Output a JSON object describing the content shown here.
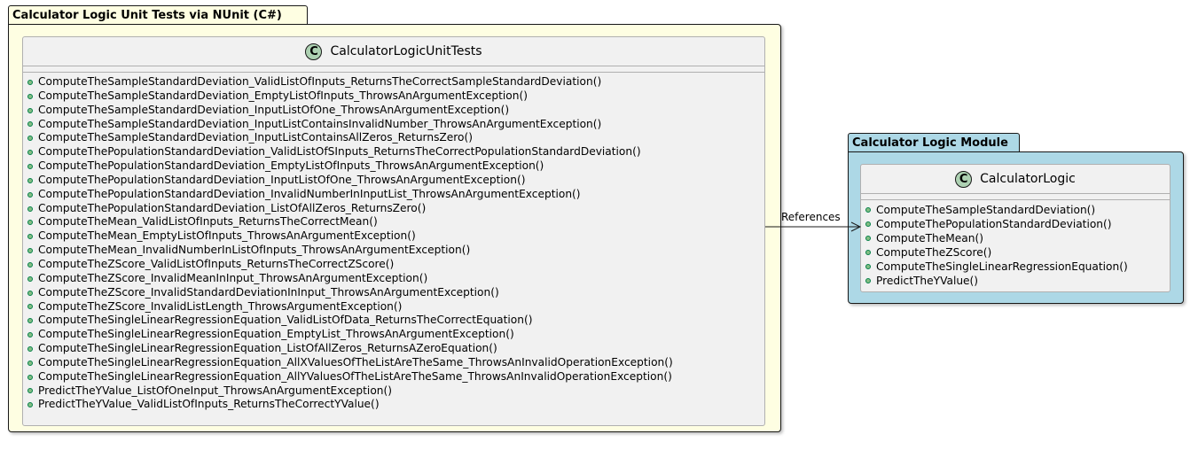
{
  "packages": {
    "tests": {
      "title": "Calculator Logic Unit Tests via NUnit (C#)",
      "color": "#fefee2",
      "class": {
        "stereotype_letter": "C",
        "name": "CalculatorLogicUnitTests",
        "methods": [
          "ComputeTheSampleStandardDeviation_ValidListOfInputs_ReturnsTheCorrectSampleStandardDeviation()",
          "ComputeTheSampleStandardDeviation_EmptyListOfInputs_ThrowsAnArgumentException()",
          "ComputeTheSampleStandardDeviation_InputListOfOne_ThrowsAnArgumentException()",
          "ComputeTheSampleStandardDeviation_InputListContainsInvalidNumber_ThrowsAnArgumentException()",
          "ComputeTheSampleStandardDeviation_InputListContainsAllZeros_ReturnsZero()",
          "ComputeThePopulationStandardDeviation_ValidListOfSInputs_ReturnsTheCorrectPopulationStandardDeviation()",
          "ComputeThePopulationStandardDeviation_EmptyListOfInputs_ThrowsAnArgumentException()",
          "ComputeThePopulationStandardDeviation_InputListOfOne_ThrowsAnArgumentException()",
          "ComputeThePopulationStandardDeviation_InvalidNumberInInputList_ThrowsAnArgumentException()",
          "ComputeThePopulationStandardDeviation_ListOfAllZeros_ReturnsZero()",
          "ComputeTheMean_ValidListOfInputs_ReturnsTheCorrectMean()",
          "ComputeTheMean_EmptyListOfInputs_ThrowsAnArgumentException()",
          "ComputeTheMean_InvalidNumberInListOfInputs_ThrowsAnArgumentException()",
          "ComputeTheZScore_ValidListOfInputs_ReturnsTheCorrectZScore()",
          "ComputeTheZScore_InvalidMeanInInput_ThrowsAnArgumentException()",
          "ComputeTheZScore_InvalidStandardDeviationInInput_ThrowsAnArgumentException()",
          "ComputeTheZScore_InvalidListLength_ThrowsArgumentException()",
          "ComputeTheSingleLinearRegressionEquation_ValidListOfData_ReturnsTheCorrectEquation()",
          "ComputeTheSingleLinearRegressionEquation_EmptyList_ThrowsAnArgumentException()",
          "ComputeTheSingleLinearRegressionEquation_ListOfAllZeros_ReturnsAZeroEquation()",
          "ComputeTheSingleLinearRegressionEquation_AllXValuesOfTheListAreTheSame_ThrowsAnInvalidOperationException()",
          "ComputeTheSingleLinearRegressionEquation_AllYValuesOfTheListAreTheSame_ThrowsAnInvalidOperationException()",
          "PredictTheYValue_ListOfOneInput_ThrowsAnArgumentException()",
          "PredictTheYValue_ValidListOfInputs_ReturnsTheCorrectYValue()"
        ]
      }
    },
    "module": {
      "title": "Calculator Logic Module",
      "color": "#add8e6",
      "class": {
        "stereotype_letter": "C",
        "name": "CalculatorLogic",
        "methods": [
          "ComputeTheSampleStandardDeviation()",
          "ComputeThePopulationStandardDeviation()",
          "ComputeTheMean()",
          "ComputeTheZScore()",
          "ComputeTheSingleLinearRegressionEquation()",
          "PredictTheYValue()"
        ]
      }
    }
  },
  "relation": {
    "label": "References",
    "from": "CalculatorLogicUnitTests",
    "to": "CalculatorLogic"
  },
  "colors": {
    "class_icon": "#add1b2",
    "method_dot": "#84be84",
    "border": "#181818"
  }
}
